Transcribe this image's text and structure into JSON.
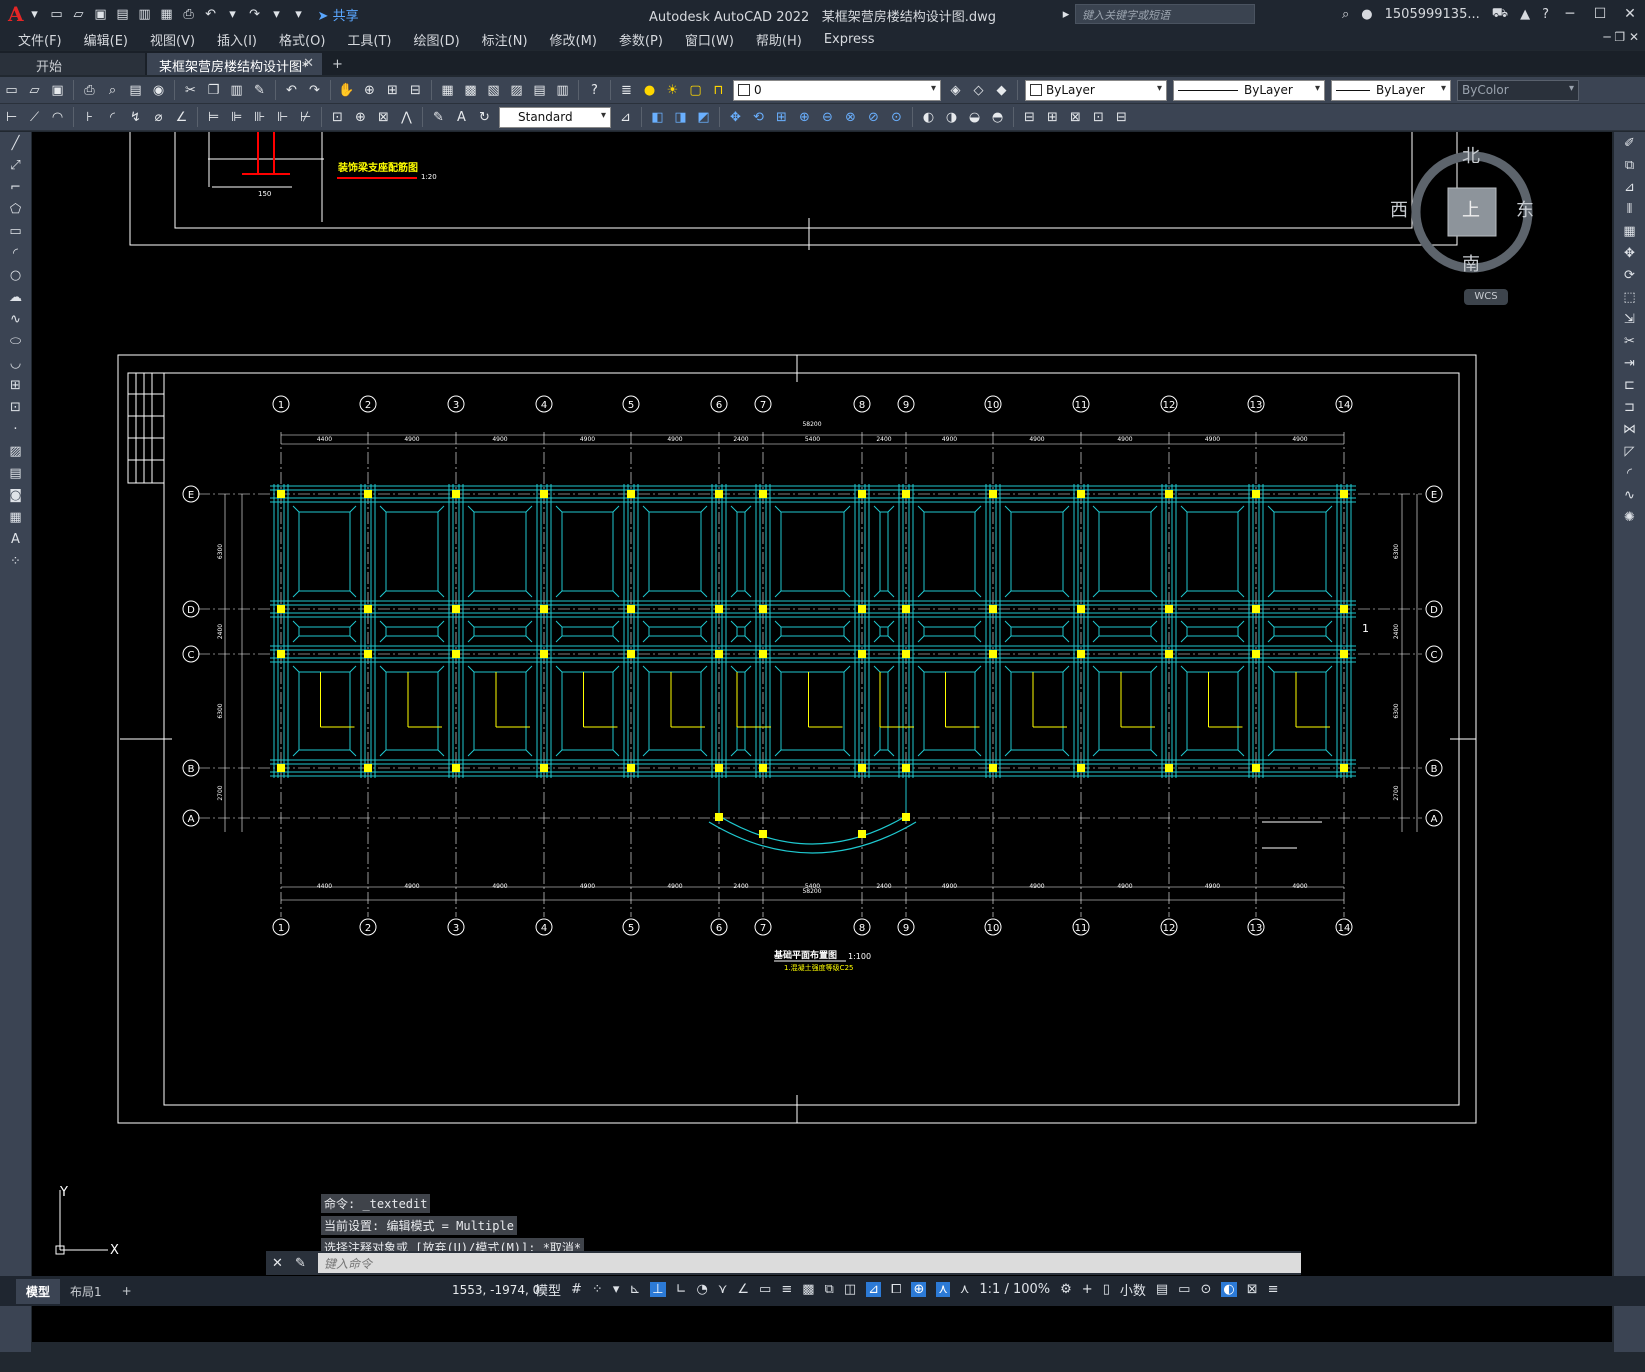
{
  "titlebar": {
    "app_title": "Autodesk AutoCAD 2022",
    "file_title": "某框架营房楼结构设计图.dwg",
    "share_label": "共享",
    "search_placeholder": "键入关键字或短语",
    "user": "1505999135...",
    "logo": "A"
  },
  "menu": [
    "文件(F)",
    "编辑(E)",
    "视图(V)",
    "插入(I)",
    "格式(O)",
    "工具(T)",
    "绘图(D)",
    "标注(N)",
    "修改(M)",
    "参数(P)",
    "窗口(W)",
    "帮助(H)",
    "Express"
  ],
  "tabs": {
    "start": "开始",
    "active": "某框架营房楼结构设计图*"
  },
  "toolbar": {
    "layer_value": "0",
    "color_value": "ByLayer",
    "linetype_value": "ByLayer",
    "lineweight_value": "ByLayer",
    "plotstyle_value": "ByColor",
    "textstyle_value": "Standard"
  },
  "viewcube": {
    "north": "北",
    "south": "南",
    "east": "东",
    "west": "西",
    "top": "上",
    "wcs": "WCS"
  },
  "drawing": {
    "detail_title": "装饰梁支座配筋图",
    "detail_scale": "1:20",
    "detail_dim": "150",
    "plan_title": "基础平面布置图",
    "plan_scale": "1:100",
    "plan_note": "1.混凝土强度等级C25",
    "grid_cols": [
      "1",
      "2",
      "3",
      "4",
      "5",
      "6",
      "7",
      "8",
      "9",
      "10",
      "11",
      "12",
      "13",
      "14"
    ],
    "grid_rows": [
      "E",
      "D",
      "C",
      "B",
      "A"
    ],
    "total_dim": "58200",
    "bay_dims": [
      "4400",
      "4900",
      "4900",
      "4900",
      "4900",
      "2400",
      "5400",
      "2400",
      "4900",
      "4900",
      "4900",
      "4900",
      "4900"
    ],
    "row_dims": [
      "6300",
      "2400",
      "6300",
      "2700"
    ],
    "section_mark": "1"
  },
  "command": {
    "history": [
      "命令: _textedit",
      "当前设置: 编辑模式 = Multiple",
      "选择注释对象或 [放弃(U)/模式(M)]: *取消*"
    ],
    "placeholder": "键入命令"
  },
  "ucs": {
    "x": "X",
    "y": "Y"
  },
  "status": {
    "tabs": [
      "模型",
      "布局1"
    ],
    "coords": "1553, -1974, 0",
    "space": "模型",
    "scale": "1:1 / 100%",
    "units": "小数"
  },
  "colors": {
    "canvas_bg": "#000000",
    "beam_cyan": "#1fc9d0",
    "column_yellow": "#ffff00",
    "label_yellow": "#ffff00",
    "title_red": "#ff0000",
    "ui_panel": "#3b4453"
  }
}
